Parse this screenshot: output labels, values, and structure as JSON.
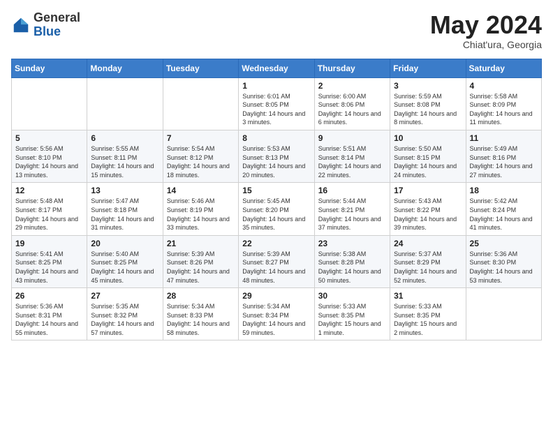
{
  "header": {
    "logo_general": "General",
    "logo_blue": "Blue",
    "month_title": "May 2024",
    "location": "Chiat'ura, Georgia"
  },
  "weekdays": [
    "Sunday",
    "Monday",
    "Tuesday",
    "Wednesday",
    "Thursday",
    "Friday",
    "Saturday"
  ],
  "weeks": [
    [
      {
        "day": "",
        "sunrise": "",
        "sunset": "",
        "daylight": ""
      },
      {
        "day": "",
        "sunrise": "",
        "sunset": "",
        "daylight": ""
      },
      {
        "day": "",
        "sunrise": "",
        "sunset": "",
        "daylight": ""
      },
      {
        "day": "1",
        "sunrise": "Sunrise: 6:01 AM",
        "sunset": "Sunset: 8:05 PM",
        "daylight": "Daylight: 14 hours and 3 minutes."
      },
      {
        "day": "2",
        "sunrise": "Sunrise: 6:00 AM",
        "sunset": "Sunset: 8:06 PM",
        "daylight": "Daylight: 14 hours and 6 minutes."
      },
      {
        "day": "3",
        "sunrise": "Sunrise: 5:59 AM",
        "sunset": "Sunset: 8:08 PM",
        "daylight": "Daylight: 14 hours and 8 minutes."
      },
      {
        "day": "4",
        "sunrise": "Sunrise: 5:58 AM",
        "sunset": "Sunset: 8:09 PM",
        "daylight": "Daylight: 14 hours and 11 minutes."
      }
    ],
    [
      {
        "day": "5",
        "sunrise": "Sunrise: 5:56 AM",
        "sunset": "Sunset: 8:10 PM",
        "daylight": "Daylight: 14 hours and 13 minutes."
      },
      {
        "day": "6",
        "sunrise": "Sunrise: 5:55 AM",
        "sunset": "Sunset: 8:11 PM",
        "daylight": "Daylight: 14 hours and 15 minutes."
      },
      {
        "day": "7",
        "sunrise": "Sunrise: 5:54 AM",
        "sunset": "Sunset: 8:12 PM",
        "daylight": "Daylight: 14 hours and 18 minutes."
      },
      {
        "day": "8",
        "sunrise": "Sunrise: 5:53 AM",
        "sunset": "Sunset: 8:13 PM",
        "daylight": "Daylight: 14 hours and 20 minutes."
      },
      {
        "day": "9",
        "sunrise": "Sunrise: 5:51 AM",
        "sunset": "Sunset: 8:14 PM",
        "daylight": "Daylight: 14 hours and 22 minutes."
      },
      {
        "day": "10",
        "sunrise": "Sunrise: 5:50 AM",
        "sunset": "Sunset: 8:15 PM",
        "daylight": "Daylight: 14 hours and 24 minutes."
      },
      {
        "day": "11",
        "sunrise": "Sunrise: 5:49 AM",
        "sunset": "Sunset: 8:16 PM",
        "daylight": "Daylight: 14 hours and 27 minutes."
      }
    ],
    [
      {
        "day": "12",
        "sunrise": "Sunrise: 5:48 AM",
        "sunset": "Sunset: 8:17 PM",
        "daylight": "Daylight: 14 hours and 29 minutes."
      },
      {
        "day": "13",
        "sunrise": "Sunrise: 5:47 AM",
        "sunset": "Sunset: 8:18 PM",
        "daylight": "Daylight: 14 hours and 31 minutes."
      },
      {
        "day": "14",
        "sunrise": "Sunrise: 5:46 AM",
        "sunset": "Sunset: 8:19 PM",
        "daylight": "Daylight: 14 hours and 33 minutes."
      },
      {
        "day": "15",
        "sunrise": "Sunrise: 5:45 AM",
        "sunset": "Sunset: 8:20 PM",
        "daylight": "Daylight: 14 hours and 35 minutes."
      },
      {
        "day": "16",
        "sunrise": "Sunrise: 5:44 AM",
        "sunset": "Sunset: 8:21 PM",
        "daylight": "Daylight: 14 hours and 37 minutes."
      },
      {
        "day": "17",
        "sunrise": "Sunrise: 5:43 AM",
        "sunset": "Sunset: 8:22 PM",
        "daylight": "Daylight: 14 hours and 39 minutes."
      },
      {
        "day": "18",
        "sunrise": "Sunrise: 5:42 AM",
        "sunset": "Sunset: 8:24 PM",
        "daylight": "Daylight: 14 hours and 41 minutes."
      }
    ],
    [
      {
        "day": "19",
        "sunrise": "Sunrise: 5:41 AM",
        "sunset": "Sunset: 8:25 PM",
        "daylight": "Daylight: 14 hours and 43 minutes."
      },
      {
        "day": "20",
        "sunrise": "Sunrise: 5:40 AM",
        "sunset": "Sunset: 8:25 PM",
        "daylight": "Daylight: 14 hours and 45 minutes."
      },
      {
        "day": "21",
        "sunrise": "Sunrise: 5:39 AM",
        "sunset": "Sunset: 8:26 PM",
        "daylight": "Daylight: 14 hours and 47 minutes."
      },
      {
        "day": "22",
        "sunrise": "Sunrise: 5:39 AM",
        "sunset": "Sunset: 8:27 PM",
        "daylight": "Daylight: 14 hours and 48 minutes."
      },
      {
        "day": "23",
        "sunrise": "Sunrise: 5:38 AM",
        "sunset": "Sunset: 8:28 PM",
        "daylight": "Daylight: 14 hours and 50 minutes."
      },
      {
        "day": "24",
        "sunrise": "Sunrise: 5:37 AM",
        "sunset": "Sunset: 8:29 PM",
        "daylight": "Daylight: 14 hours and 52 minutes."
      },
      {
        "day": "25",
        "sunrise": "Sunrise: 5:36 AM",
        "sunset": "Sunset: 8:30 PM",
        "daylight": "Daylight: 14 hours and 53 minutes."
      }
    ],
    [
      {
        "day": "26",
        "sunrise": "Sunrise: 5:36 AM",
        "sunset": "Sunset: 8:31 PM",
        "daylight": "Daylight: 14 hours and 55 minutes."
      },
      {
        "day": "27",
        "sunrise": "Sunrise: 5:35 AM",
        "sunset": "Sunset: 8:32 PM",
        "daylight": "Daylight: 14 hours and 57 minutes."
      },
      {
        "day": "28",
        "sunrise": "Sunrise: 5:34 AM",
        "sunset": "Sunset: 8:33 PM",
        "daylight": "Daylight: 14 hours and 58 minutes."
      },
      {
        "day": "29",
        "sunrise": "Sunrise: 5:34 AM",
        "sunset": "Sunset: 8:34 PM",
        "daylight": "Daylight: 14 hours and 59 minutes."
      },
      {
        "day": "30",
        "sunrise": "Sunrise: 5:33 AM",
        "sunset": "Sunset: 8:35 PM",
        "daylight": "Daylight: 15 hours and 1 minute."
      },
      {
        "day": "31",
        "sunrise": "Sunrise: 5:33 AM",
        "sunset": "Sunset: 8:35 PM",
        "daylight": "Daylight: 15 hours and 2 minutes."
      },
      {
        "day": "",
        "sunrise": "",
        "sunset": "",
        "daylight": ""
      }
    ]
  ]
}
